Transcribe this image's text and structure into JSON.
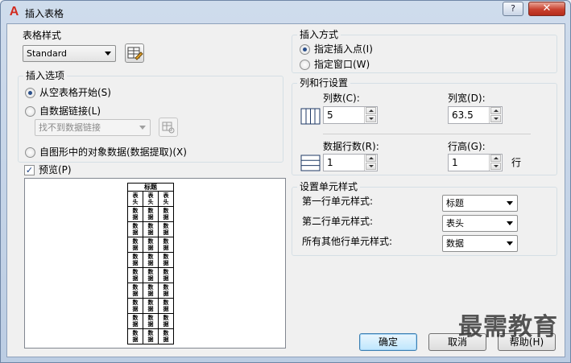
{
  "window": {
    "title": "插入表格",
    "help": "?",
    "close": "✕"
  },
  "table_style": {
    "group_title": "表格样式",
    "value": "Standard"
  },
  "insert_options": {
    "group_title": "插入选项",
    "from_empty": "从空表格开始(S)",
    "from_data_link": "自数据链接(L)",
    "data_link_value": "找不到数据链接",
    "from_object_data": "自图形中的对象数据(数据提取)(X)"
  },
  "preview": {
    "checkbox_label": "预览(P)",
    "table_title": "标题",
    "header_cell": "表头",
    "data_cell": "数据",
    "rows": 10,
    "cols": 3
  },
  "insert_method": {
    "group_title": "插入方式",
    "insertion_point": "指定插入点(I)",
    "window": "指定窗口(W)"
  },
  "cols_rows": {
    "group_title": "列和行设置",
    "columns_label": "列数(C):",
    "columns_value": "5",
    "col_width_label": "列宽(D):",
    "col_width_value": "63.5",
    "data_rows_label": "数据行数(R):",
    "data_rows_value": "1",
    "row_height_label": "行高(G):",
    "row_height_value": "1",
    "row_unit": "行"
  },
  "cell_styles": {
    "group_title": "设置单元样式",
    "first_row_label": "第一行单元样式:",
    "first_row_value": "标题",
    "second_row_label": "第二行单元样式:",
    "second_row_value": "表头",
    "other_rows_label": "所有其他行单元样式:",
    "other_rows_value": "数据"
  },
  "buttons": {
    "ok": "确定",
    "cancel": "取消",
    "help": "帮助(H)"
  },
  "watermark": "最需教育"
}
